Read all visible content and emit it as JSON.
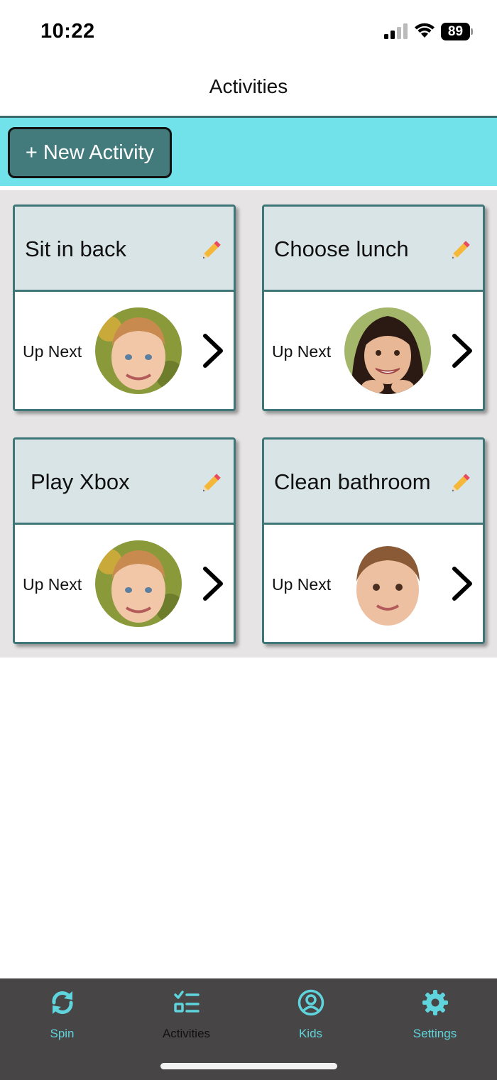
{
  "status_bar": {
    "time": "10:22",
    "battery": "89"
  },
  "header": {
    "title": "Activities"
  },
  "toolbar": {
    "new_activity_label": "+ New Activity"
  },
  "activities": [
    {
      "title": "Sit in back",
      "next_label": "Up Next",
      "kid_avatar": "blond-boy-avatar"
    },
    {
      "title": "Choose lunch",
      "next_label": "Up Next",
      "kid_avatar": "dark-haired-girl-avatar"
    },
    {
      "title": "Play Xbox",
      "next_label": "Up Next",
      "kid_avatar": "blond-boy-avatar"
    },
    {
      "title": "Clean bathroom",
      "next_label": "Up Next",
      "kid_avatar": "toddler-boy-avatar"
    }
  ],
  "tabbar": {
    "tabs": [
      {
        "label": "Spin",
        "icon": "spin-arrows-icon",
        "active": false
      },
      {
        "label": "Activities",
        "icon": "checklist-icon",
        "active": true
      },
      {
        "label": "Kids",
        "icon": "user-circle-icon",
        "active": false
      },
      {
        "label": "Settings",
        "icon": "gear-icon",
        "active": false
      }
    ]
  },
  "colors": {
    "accent": "#71e2e9",
    "teal_dark": "#3f7677",
    "button": "#437b7d",
    "card_header": "#d9e4e6",
    "tabbar": "#474545",
    "tab_icon": "#5fd4dc",
    "tab_active_label": "#111111"
  }
}
